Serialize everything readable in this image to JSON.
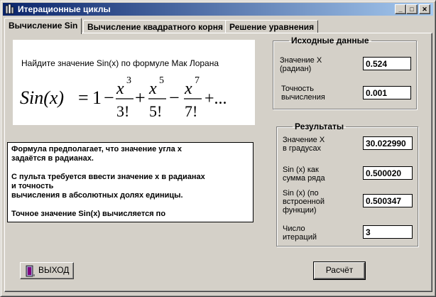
{
  "window": {
    "title": "Итерационные циклы",
    "minimize_glyph": "_",
    "maximize_glyph": "□",
    "close_glyph": "✕"
  },
  "tabs": [
    {
      "label": "Вычисление Sin"
    },
    {
      "label": "Вычисление квадратного корня"
    },
    {
      "label": "Решение уравнения"
    }
  ],
  "formula": {
    "caption": "Найдите значение Sin(x) по формуле Мак Лорана",
    "lhs": "Sin(x)",
    "equals": "=",
    "one": "1",
    "minus": "−",
    "plus": "+",
    "x": "x",
    "powers": [
      "3",
      "5",
      "7"
    ],
    "factorials": [
      "3!",
      "5!",
      "7!"
    ],
    "ellipsis": "+..."
  },
  "info": {
    "p1_line1": "Формула предполагает, что значение угла х",
    "p1_line2": "задаётся в радианах.",
    "p2_line1": "С пульта требуется ввести значение х в радианах",
    "p2_line2": "и точность",
    "p2_line3": "вычисления в абсолютных долях единицы.",
    "p3_line1": "Точное значение Sin(x) вычисляется по"
  },
  "input_group": {
    "title": "Исходные данные",
    "x_label_1": "Значение X",
    "x_label_2": "(радиан)",
    "x_value": "0.524",
    "eps_label_1": "Точность",
    "eps_label_2": "вычисления",
    "eps_value": "0.001"
  },
  "results_group": {
    "title": "Результаты",
    "deg_label_1": "Значение X",
    "deg_label_2": " в градусах",
    "deg_value": "30.022990",
    "series_label_1": "Sin (x)  как",
    "series_label_2": "сумма ряда",
    "series_value": "0.500020",
    "builtin_label_1": "Sin (x)    (по",
    "builtin_label_2": "встроенной",
    "builtin_label_3": "функции)",
    "builtin_value": "0.500347",
    "iter_label_1": "Число",
    "iter_label_2": "итераций",
    "iter_value": "3"
  },
  "buttons": {
    "exit_label": "ВЫХОД",
    "calc_label": "Расчёт"
  },
  "colors": {
    "titlebar_start": "#0a246a",
    "titlebar_end": "#a6caf0",
    "face": "#d4d0c8"
  },
  "icons": [
    "app-icon",
    "door-exit-icon"
  ]
}
